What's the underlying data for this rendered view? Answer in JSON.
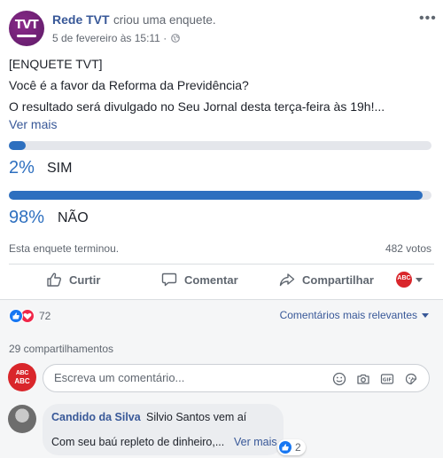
{
  "post": {
    "author": "Rede TVT",
    "action": "criou uma enquete.",
    "timestamp": "5 de fevereiro às 15:11 ·",
    "avatar_text": "TVT",
    "text_lines": [
      "[ENQUETE TVT]",
      "Você é a favor da Reforma da Previdência?",
      "O resultado será divulgado no Seu Jornal desta terça-feira às 19h!..."
    ],
    "see_more": "Ver mais"
  },
  "poll": {
    "options": [
      {
        "label": "SIM",
        "percent_label": "2%",
        "percent": 2
      },
      {
        "label": "NÃO",
        "percent_label": "98%",
        "percent": 98
      }
    ],
    "status": "Esta enquete terminou.",
    "votes": "482 votos",
    "bar_color": "#2d6fbf"
  },
  "actions": {
    "like": "Curtir",
    "comment": "Comentar",
    "share": "Compartilhar",
    "page_avatar_text": "ABC"
  },
  "engagement": {
    "reaction_count": "72",
    "sort_label": "Comentários mais relevantes",
    "shares": "29 compartilhamentos"
  },
  "composer": {
    "avatar_line1": "ABC",
    "avatar_line2": "ABC",
    "placeholder": "Escreva um comentário...",
    "icons": [
      "emoji-icon",
      "camera-icon",
      "gif-icon",
      "sticker-icon"
    ]
  },
  "comment": {
    "name": "Candido da Silva",
    "text_first": "Silvio Santos vem aí",
    "text_second": "Com seu baú repleto de dinheiro,...",
    "see_more": "Ver mais",
    "reaction_count": "2"
  },
  "colors": {
    "link": "#385898",
    "accent": "#2d6fbf",
    "brand_purple": "#6b1f73",
    "abc_red": "#d9262b"
  }
}
